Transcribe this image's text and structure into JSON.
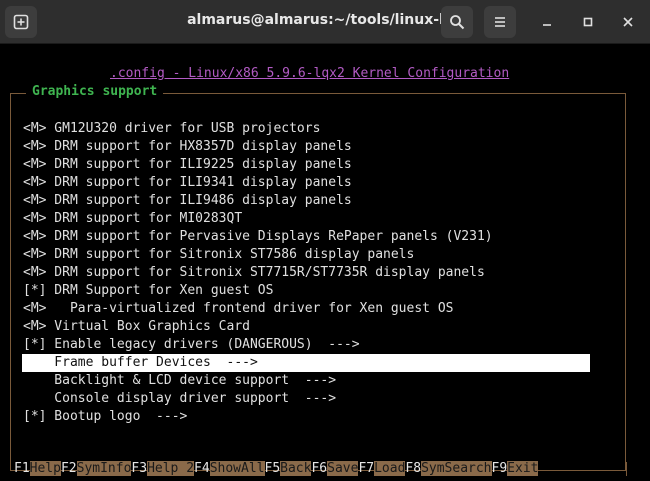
{
  "window": {
    "title": "almarus@almarus:~/tools/linux-lqx",
    "new_tab_icon": "new-tab-icon",
    "search_icon": "search-icon",
    "menu_icon": "hamburger-menu-icon"
  },
  "config_title": ".config - Linux/x86 5.9.6-lqx2 Kernel Configuration",
  "section_title": "Graphics support",
  "items": [
    {
      "text": "<M> GM12U320 driver for USB projectors"
    },
    {
      "text": "<M> DRM support for HX8357D display panels"
    },
    {
      "text": "<M> DRM support for ILI9225 display panels"
    },
    {
      "text": "<M> DRM support for ILI9341 display panels"
    },
    {
      "text": "<M> DRM support for ILI9486 display panels"
    },
    {
      "text": "<M> DRM support for MI0283QT"
    },
    {
      "text": "<M> DRM support for Pervasive Displays RePaper panels (V231)"
    },
    {
      "text": "<M> DRM support for Sitronix ST7586 display panels"
    },
    {
      "text": "<M> DRM support for Sitronix ST7715R/ST7735R display panels"
    },
    {
      "text": "[*] DRM Support for Xen guest OS"
    },
    {
      "text": "<M>   Para-virtualized frontend driver for Xen guest OS"
    },
    {
      "text": "<M> Virtual Box Graphics Card"
    },
    {
      "text": "[*] Enable legacy drivers (DANGEROUS)  --->"
    },
    {
      "text": "    Frame buffer Devices  --->",
      "selected": true
    },
    {
      "text": "    Backlight & LCD device support  --->"
    },
    {
      "text": "    Console display driver support  --->"
    },
    {
      "text": "[*] Bootup logo  --->"
    }
  ],
  "function_keys": [
    {
      "key": "F1",
      "label": "Help"
    },
    {
      "key": "F2",
      "label": "SymInfo"
    },
    {
      "key": "F3",
      "label": "Help 2"
    },
    {
      "key": "F4",
      "label": "ShowAll"
    },
    {
      "key": "F5",
      "label": "Back"
    },
    {
      "key": "F6",
      "label": "Save"
    },
    {
      "key": "F7",
      "label": "Load"
    },
    {
      "key": "F8",
      "label": "SymSearch"
    },
    {
      "key": "F9",
      "label": "Exit"
    }
  ],
  "colors": {
    "titlebar": "#2e2e2e",
    "config_title": "#b35bc5",
    "section_title": "#3fb450",
    "frame_border": "#7a5a3a",
    "fkey_label_bg": "#8a6a4a",
    "selection_bg": "#ffffff"
  }
}
